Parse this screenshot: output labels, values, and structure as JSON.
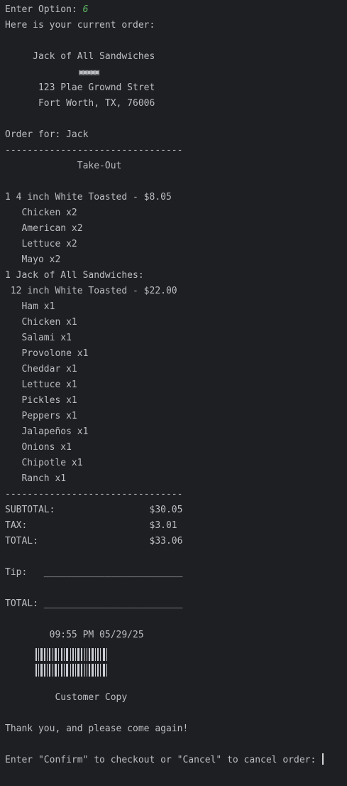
{
  "prompt": {
    "label": "Enter Option: ",
    "value": "6"
  },
  "header_line": "Here is your current order:",
  "store": {
    "name": "Jack of All Sandwiches",
    "name_line": "     Jack of All Sandwiches",
    "logo_glyphs": "▣▣▣▣▣",
    "address_line1": "      123 Plae Grownd Stret",
    "address_line2": "      Fort Worth, TX, 76006"
  },
  "order_for": "Order for: Jack",
  "divider": "--------------------------------",
  "order_type": "             Take-Out",
  "items": [
    {
      "line": "1 4 inch White Toasted - $8.05",
      "toppings": [
        "   Chicken x2",
        "   American x2",
        "   Lettuce x2",
        "   Mayo x2"
      ]
    },
    {
      "line": "1 Jack of All Sandwiches:",
      "subline": " 12 inch White Toasted - $22.00",
      "toppings": [
        "   Ham x1",
        "   Chicken x1",
        "   Salami x1",
        "   Provolone x1",
        "   Cheddar x1",
        "   Lettuce x1",
        "   Pickles x1",
        "   Peppers x1",
        "   Jalapeños x1",
        "   Onions x1",
        "   Chipotle x1",
        "   Ranch x1"
      ]
    }
  ],
  "totals": {
    "subtotal_line": "SUBTOTAL:                 $30.05",
    "tax_line": "TAX:                      $3.01",
    "total_line": "TOTAL:                    $33.06"
  },
  "tip_line": "Tip:   _________________________",
  "total_sign_line": "TOTAL: _________________________",
  "timestamp": "        09:55 PM 05/29/25",
  "copy_label": "         Customer Copy",
  "thanks": "Thank you, and please come again!",
  "final_prompt": "Enter \"Confirm\" to checkout or \"Cancel\" to cancel order: ",
  "colors": {
    "background": "#1e1f22",
    "text": "#bcbec4",
    "input": "#5fb865"
  }
}
